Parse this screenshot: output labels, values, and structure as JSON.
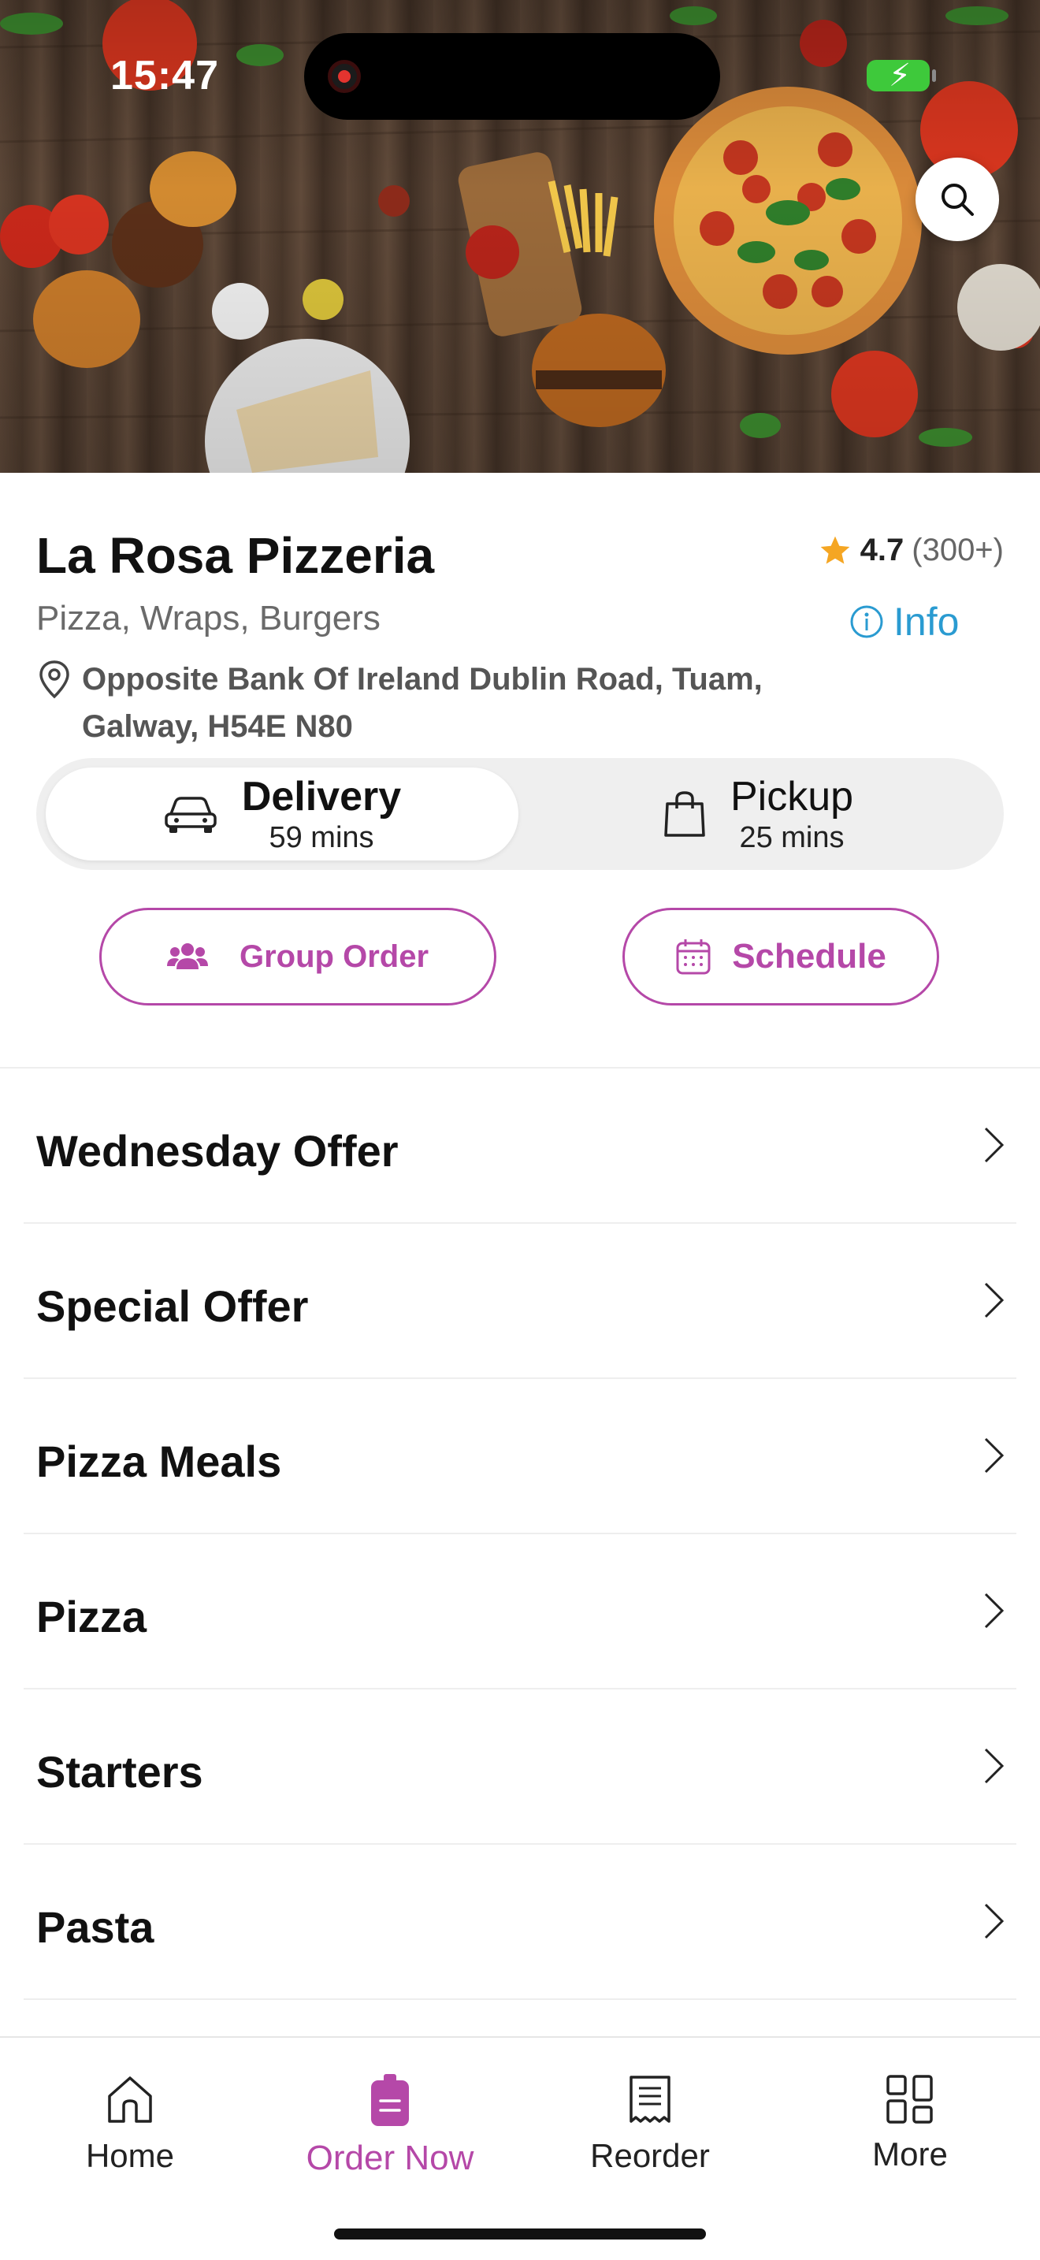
{
  "status_bar": {
    "time": "15:47"
  },
  "restaurant": {
    "name": "La Rosa Pizzeria",
    "rating": "4.7",
    "rating_count": "(300+)",
    "cuisines": "Pizza, Wraps, Burgers",
    "info_label": "Info",
    "address_line1": "Opposite Bank Of Ireland Dublin Road, Tuam,",
    "address_line2": "Galway, H54E N80"
  },
  "modes": {
    "delivery": {
      "label": "Delivery",
      "time": "59 mins",
      "selected": true
    },
    "pickup": {
      "label": "Pickup",
      "time": "25 mins",
      "selected": false
    }
  },
  "actions": {
    "group_order": "Group Order",
    "schedule": "Schedule"
  },
  "categories": [
    {
      "label": "Wednesday Offer"
    },
    {
      "label": "Special Offer"
    },
    {
      "label": "Pizza Meals"
    },
    {
      "label": "Pizza"
    },
    {
      "label": "Starters"
    },
    {
      "label": "Pasta"
    }
  ],
  "bottom_nav": [
    {
      "label": "Home",
      "icon": "home-icon"
    },
    {
      "label": "Order Now",
      "icon": "order-icon",
      "active": true
    },
    {
      "label": "Reorder",
      "icon": "receipt-icon"
    },
    {
      "label": "More",
      "icon": "grid-icon"
    }
  ],
  "colors": {
    "accent": "#b548a8",
    "info": "#2a9bd1",
    "star": "#f5a623",
    "toggle_bg": "#efefef"
  }
}
